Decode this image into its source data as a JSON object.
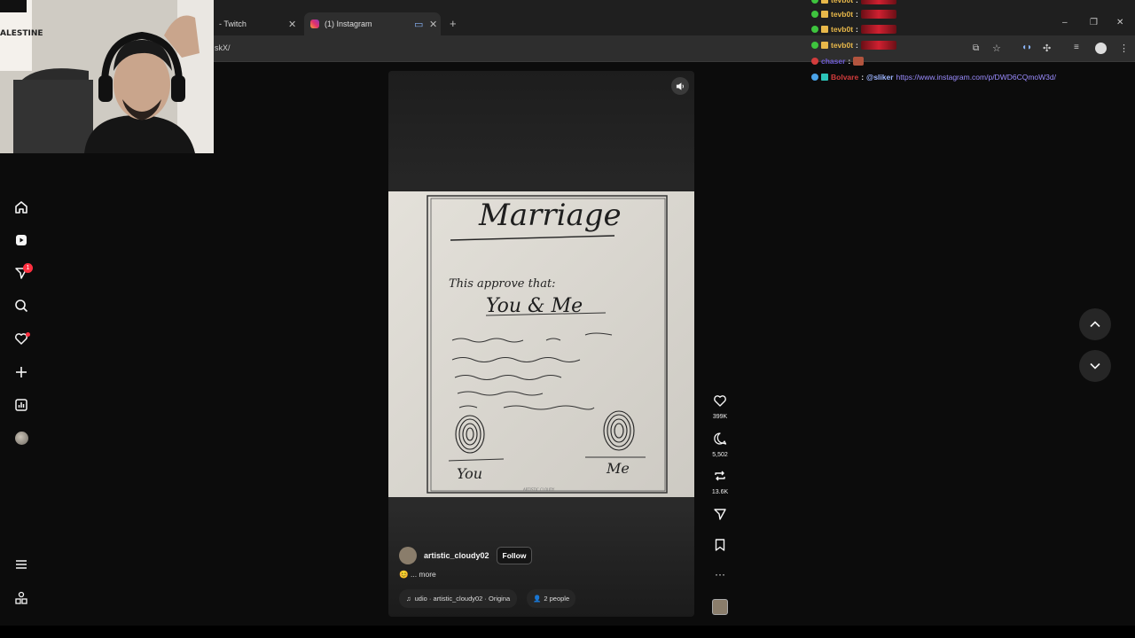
{
  "browser": {
    "tabs": [
      {
        "label": "- Twitch",
        "active": false
      },
      {
        "label": "(1) Instagram",
        "active": true
      }
    ],
    "new_tab": "+",
    "url": "skX/",
    "window": {
      "minimize": "–",
      "restore": "❐",
      "close": "✕"
    }
  },
  "webcam": {
    "flag_text": "ALESTINE"
  },
  "sidebar": {
    "notification_count": "1",
    "items": [
      {
        "name": "home-icon"
      },
      {
        "name": "reels-icon"
      },
      {
        "name": "messages-icon"
      },
      {
        "name": "search-icon"
      },
      {
        "name": "notifications-icon"
      },
      {
        "name": "create-icon"
      },
      {
        "name": "dashboard-icon"
      },
      {
        "name": "profile-avatar"
      },
      {
        "name": "menu-icon"
      },
      {
        "name": "more-apps-icon"
      }
    ]
  },
  "reel": {
    "drawing": {
      "title": "Marriage",
      "line1": "This approve that:",
      "line2": "You & Me",
      "sig_left": "You",
      "sig_right": "Me",
      "watermark": "ARTISTIC CLOUDY"
    },
    "actions": {
      "likes": "399K",
      "comments": "5,502",
      "reposts": "13.6K"
    },
    "author": {
      "username": "artistic_cloudy02",
      "follow_label": "Follow"
    },
    "caption": {
      "emoji": "😊",
      "more": "... more"
    },
    "audio": {
      "text": "udio · artistic_cloudy02 · Origina"
    },
    "people": {
      "text": "2 people"
    }
  },
  "chat": {
    "lines": [
      {
        "user": "tevb0t",
        "sep": ":",
        "color": "#e8b84a"
      },
      {
        "user": "tevb0t",
        "sep": ":",
        "color": "#e8b84a"
      },
      {
        "user": "tevb0t",
        "sep": ":",
        "color": "#e8b84a"
      },
      {
        "user": "tevb0t",
        "sep": ":",
        "color": "#e8b84a"
      },
      {
        "user": "chaser",
        "sep": ":",
        "color": "#6f5cd6"
      },
      {
        "user": "Bolvare",
        "sep": ":",
        "mention": "@sliker",
        "link": "https://www.instagram.com/p/DWD6CQmoW3d/",
        "color": "#d23c3c"
      }
    ]
  },
  "colors": {
    "background": "#0c0c0c",
    "accent_red": "#ff3040",
    "chat_link": "#9b8cff"
  }
}
